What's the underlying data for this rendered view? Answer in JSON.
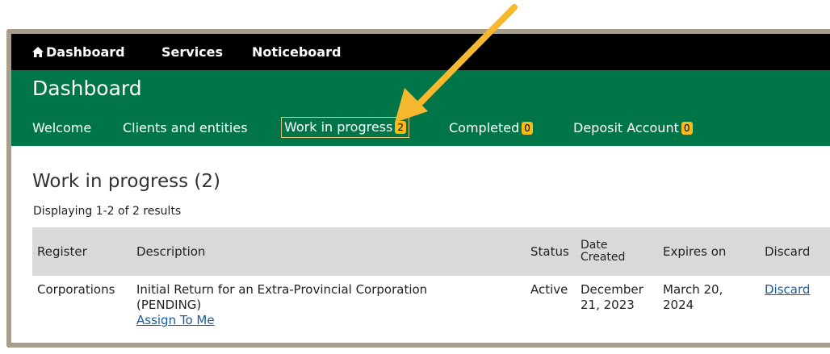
{
  "top_nav": {
    "dashboard": "Dashboard",
    "services": "Services",
    "noticeboard": "Noticeboard"
  },
  "header": {
    "title": "Dashboard",
    "tabs": [
      {
        "label": "Welcome",
        "badge": null
      },
      {
        "label": "Clients and entities",
        "badge": null
      },
      {
        "label": "Work in progress",
        "badge": "2"
      },
      {
        "label": "Completed",
        "badge": "0"
      },
      {
        "label": "Deposit Account",
        "badge": "0"
      }
    ]
  },
  "main": {
    "title": "Work in progress (2)",
    "results_info": "Displaying 1-2 of 2 results",
    "table": {
      "columns": [
        "Register",
        "Description",
        "Status",
        "Date Created",
        "Expires on",
        "Discard"
      ],
      "rows": [
        {
          "register": "Corporations",
          "description": "Initial Return for an Extra-Provincial Corporation (PENDING)",
          "assign_link": "Assign To Me",
          "status": "Active",
          "date_created": "December 21, 2023",
          "expires_on": "March 20, 2024",
          "discard_link": "Discard"
        }
      ]
    }
  },
  "colors": {
    "green_header": "#007547",
    "badge": "#fcba19",
    "arrow": "#f5b82e",
    "frame": "#a89e8a",
    "link": "#1a5a96"
  },
  "icons": [
    "home-icon",
    "callout-arrow"
  ]
}
